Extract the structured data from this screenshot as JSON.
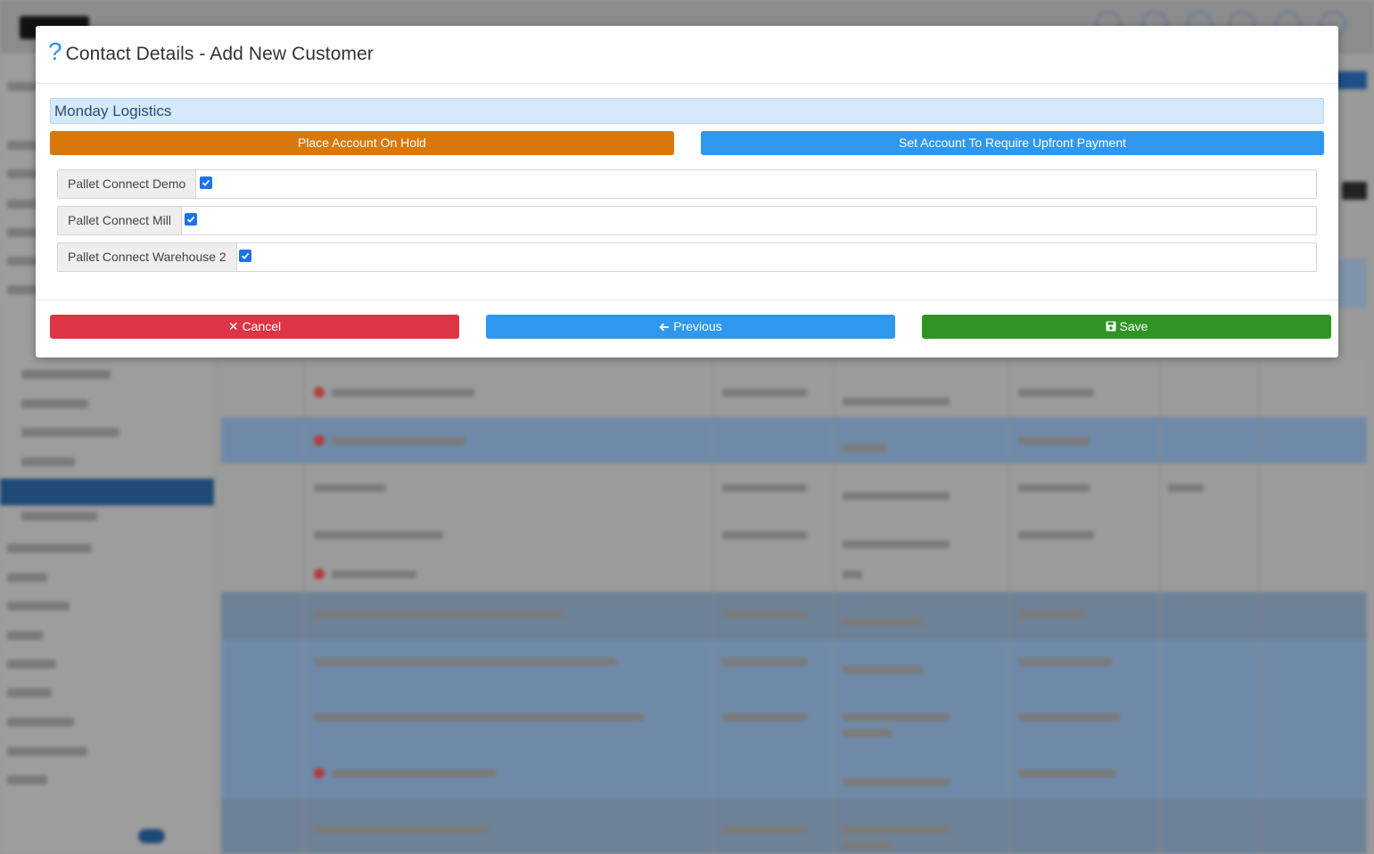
{
  "modal": {
    "title": "Contact Details - Add New Customer",
    "help_icon": "question-icon",
    "company_name": "Monday Logistics",
    "hold_button": "Place Account On Hold",
    "upfront_button": "Set Account To Require Upfront Payment",
    "warehouses": [
      {
        "label": "Pallet Connect Demo",
        "checked": true
      },
      {
        "label": "Pallet Connect Mill",
        "checked": true
      },
      {
        "label": "Pallet Connect Warehouse 2",
        "checked": true
      }
    ],
    "footer": {
      "cancel_icon": "✕",
      "cancel_label": "Cancel",
      "previous_icon": "🡐",
      "previous_label": "Previous",
      "save_label": "Save"
    }
  },
  "colors": {
    "hold": "#d9780a",
    "primary": "#2f98ee",
    "cancel": "#dc3545",
    "save": "#2f9423",
    "company_bar": "#d6e9fb"
  }
}
